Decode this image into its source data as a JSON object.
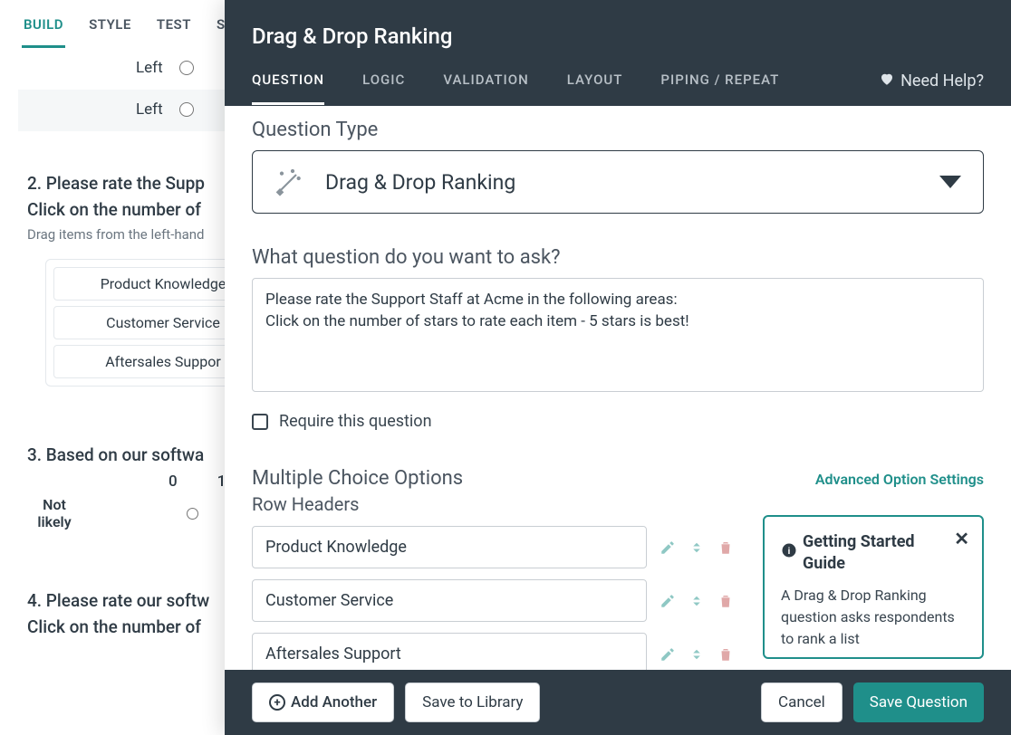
{
  "bg": {
    "tabs": [
      "BUILD",
      "STYLE",
      "TEST",
      "S"
    ],
    "active_tab": 0,
    "row_left_1": "Left",
    "row_left_2": "Left",
    "q2": {
      "title_line1": "2. Please rate the Supp",
      "title_line2": "Click on the number of",
      "hint": "Drag items from the left-hand",
      "items": [
        "Product Knowledge",
        "Customer Service",
        "Aftersales Suppor"
      ]
    },
    "q3": {
      "title": "3. Based on our softwa",
      "cols": [
        "0",
        "1"
      ],
      "row_label": "Not likely"
    },
    "q4": {
      "line1": "4. Please rate our softw",
      "line2": "Click on the number of"
    }
  },
  "modal": {
    "title": "Drag & Drop Ranking",
    "tabs": [
      "QUESTION",
      "LOGIC",
      "VALIDATION",
      "LAYOUT",
      "PIPING / REPEAT"
    ],
    "active_tab": 0,
    "need_help": "Need Help?",
    "qtype_label": "Question Type",
    "qtype_value": "Drag & Drop Ranking",
    "qprompt_label": "What question do you want to ask?",
    "qprompt_value": "Please rate the Support Staff at Acme in the following areas:\nClick on the number of stars to rate each item - 5 stars is best!",
    "require_label": "Require this question",
    "mc_label": "Multiple Choice Options",
    "adv_link": "Advanced Option Settings",
    "row_headers_label": "Row Headers",
    "rows": [
      "Product Knowledge",
      "Customer Service",
      "Aftersales Support"
    ],
    "guide": {
      "title": "Getting Started Guide",
      "body": "A Drag & Drop Ranking question asks respondents to rank a list"
    },
    "footer": {
      "add_another": "Add Another",
      "save_library": "Save to Library",
      "cancel": "Cancel",
      "save": "Save Question"
    }
  }
}
